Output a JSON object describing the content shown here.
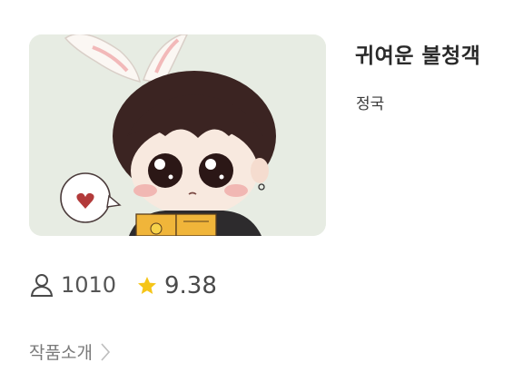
{
  "work": {
    "title": "귀여운 불청객",
    "author": "정국"
  },
  "stats": {
    "views": "1010",
    "rating": "9.38",
    "views_icon": "user-icon",
    "rating_icon": "star-icon",
    "star_color": "#f5c518"
  },
  "intro": {
    "label": "작품소개",
    "icon": "chevron-right-icon"
  },
  "cover": {
    "description_icon": "cover-image"
  }
}
